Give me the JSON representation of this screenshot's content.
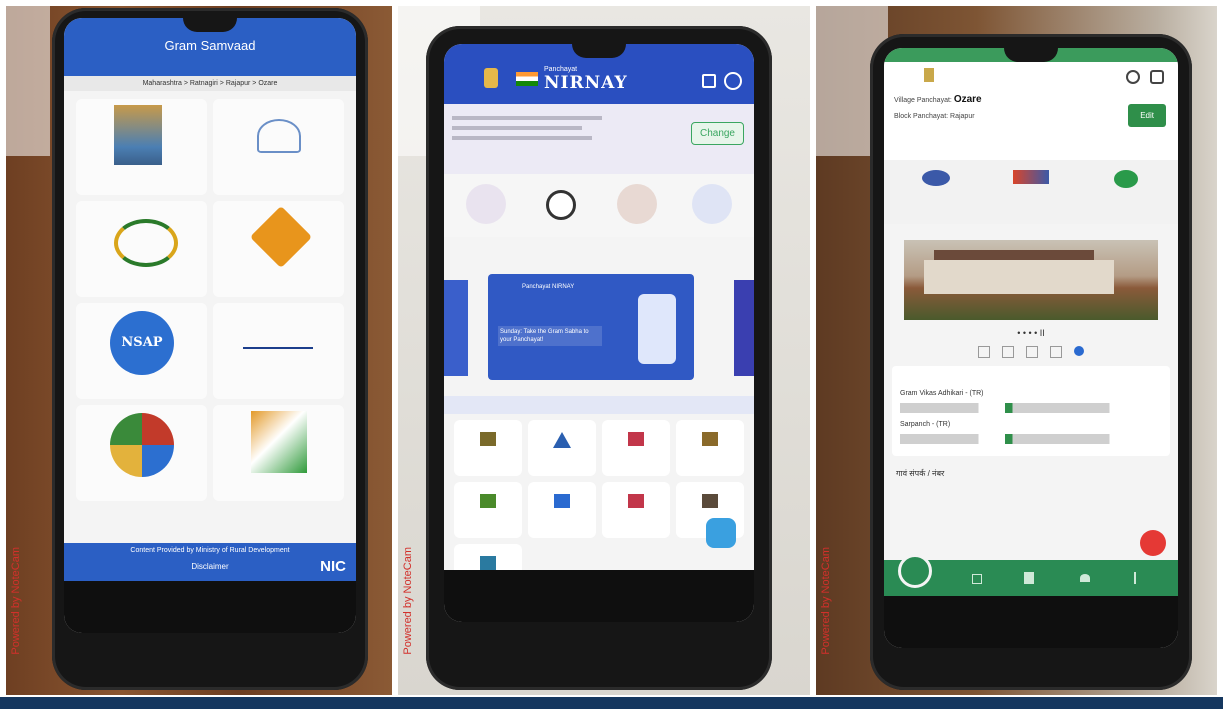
{
  "photo1": {
    "app_title": "Gram Samvaad",
    "location_path": "Maharashtra > Ratnagiri > Rajapur > Ozare",
    "tiles": [
      {
        "icon": "pmay-logo-icon"
      },
      {
        "icon": "swachh-bharat-logo-icon"
      },
      {
        "icon": "nrlm-logo-icon"
      },
      {
        "icon": "road-sign-icon"
      },
      {
        "icon": "nsap-logo-icon",
        "text": "NSAP"
      },
      {
        "icon": "pmksy-logo-icon"
      },
      {
        "icon": "collage-logo-icon"
      },
      {
        "icon": "ministry-logo-icon"
      }
    ],
    "footer_text": "Content Provided by Ministry of Rural Development",
    "footer_link": "Disclaimer",
    "nic_logo": "NIC",
    "powered_by": "Powered by NoteCam"
  },
  "photo2": {
    "brand_top": "Panchayat",
    "brand_name": "NIRNAY",
    "change_button": "Change",
    "banner_heading": "Panchayat NIRNAY",
    "banner_line1": "Sunday: Take the Gram Sabha to your Panchayat!",
    "icons": [
      {
        "icon": "panchayat-icon"
      },
      {
        "icon": "sync-icon"
      },
      {
        "icon": "meeting-icon"
      },
      {
        "icon": "people-network-icon"
      }
    ],
    "tiles": [
      {
        "icon": "building-icon"
      },
      {
        "icon": "triangle-icon"
      },
      {
        "icon": "book-icon"
      },
      {
        "icon": "box-icon"
      },
      {
        "icon": "grid-icon"
      },
      {
        "icon": "video-icon"
      },
      {
        "icon": "group-icon"
      },
      {
        "icon": "badge-icon"
      },
      {
        "icon": "gift-icon"
      }
    ],
    "powered_by": "Powered by NoteCam"
  },
  "photo3": {
    "village_label": "Village Panchayat:",
    "village_name": "Ozare",
    "block_line": "Block Panchayat: Rajapur",
    "button_label": "Edit",
    "carousel_dots": "• • • • II",
    "contact_line1": "Gram Vikas Adhikari - (TR)",
    "contact_line2": "Sarpanch - (TR)",
    "bottom_caption": "गावं संपर्क / नंबर",
    "powered_by": "Powered by NoteCam",
    "icons": [
      {
        "icon": "house-icon"
      },
      {
        "icon": "pmay-icon"
      },
      {
        "icon": "water-icon"
      }
    ]
  },
  "colors": {
    "gram_samvaad_blue": "#2b5fc4",
    "nirnay_blue": "#2a4fc0",
    "edit_green": "#2f8f4a",
    "nav_green": "#2a8b54",
    "footer_navy": "#15375f"
  }
}
